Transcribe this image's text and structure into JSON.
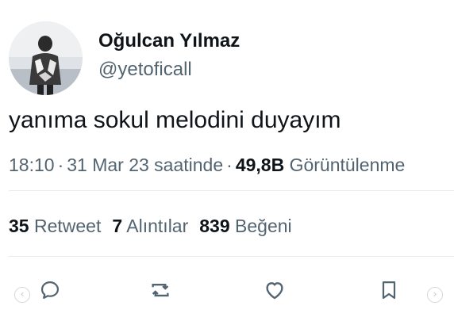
{
  "author": {
    "display_name": "Oğulcan Yılmaz",
    "handle": "@yetoficall"
  },
  "tweet": {
    "text": "yanıma sokul melodini duyayım"
  },
  "meta": {
    "time": "18:10",
    "separator": "·",
    "date_phrase": "31 Mar 23 saatinde",
    "views_count": "49,8B",
    "views_label": "Görüntülenme"
  },
  "stats": {
    "retweets": {
      "count": "35",
      "label": "Retweet"
    },
    "quotes": {
      "count": "7",
      "label": "Alıntılar"
    },
    "likes": {
      "count": "839",
      "label": "Beğeni"
    }
  },
  "actions": {
    "reply_icon": "reply-icon",
    "retweet_icon": "retweet-icon",
    "like_icon": "heart-icon",
    "bookmark_icon": "bookmark-icon",
    "icon_color": "#536471"
  },
  "carousel": {
    "prev_glyph": "‹",
    "next_glyph": "›"
  },
  "colors": {
    "text_primary": "#0f1419",
    "text_secondary": "#536471",
    "divider": "#e6ecf0"
  }
}
